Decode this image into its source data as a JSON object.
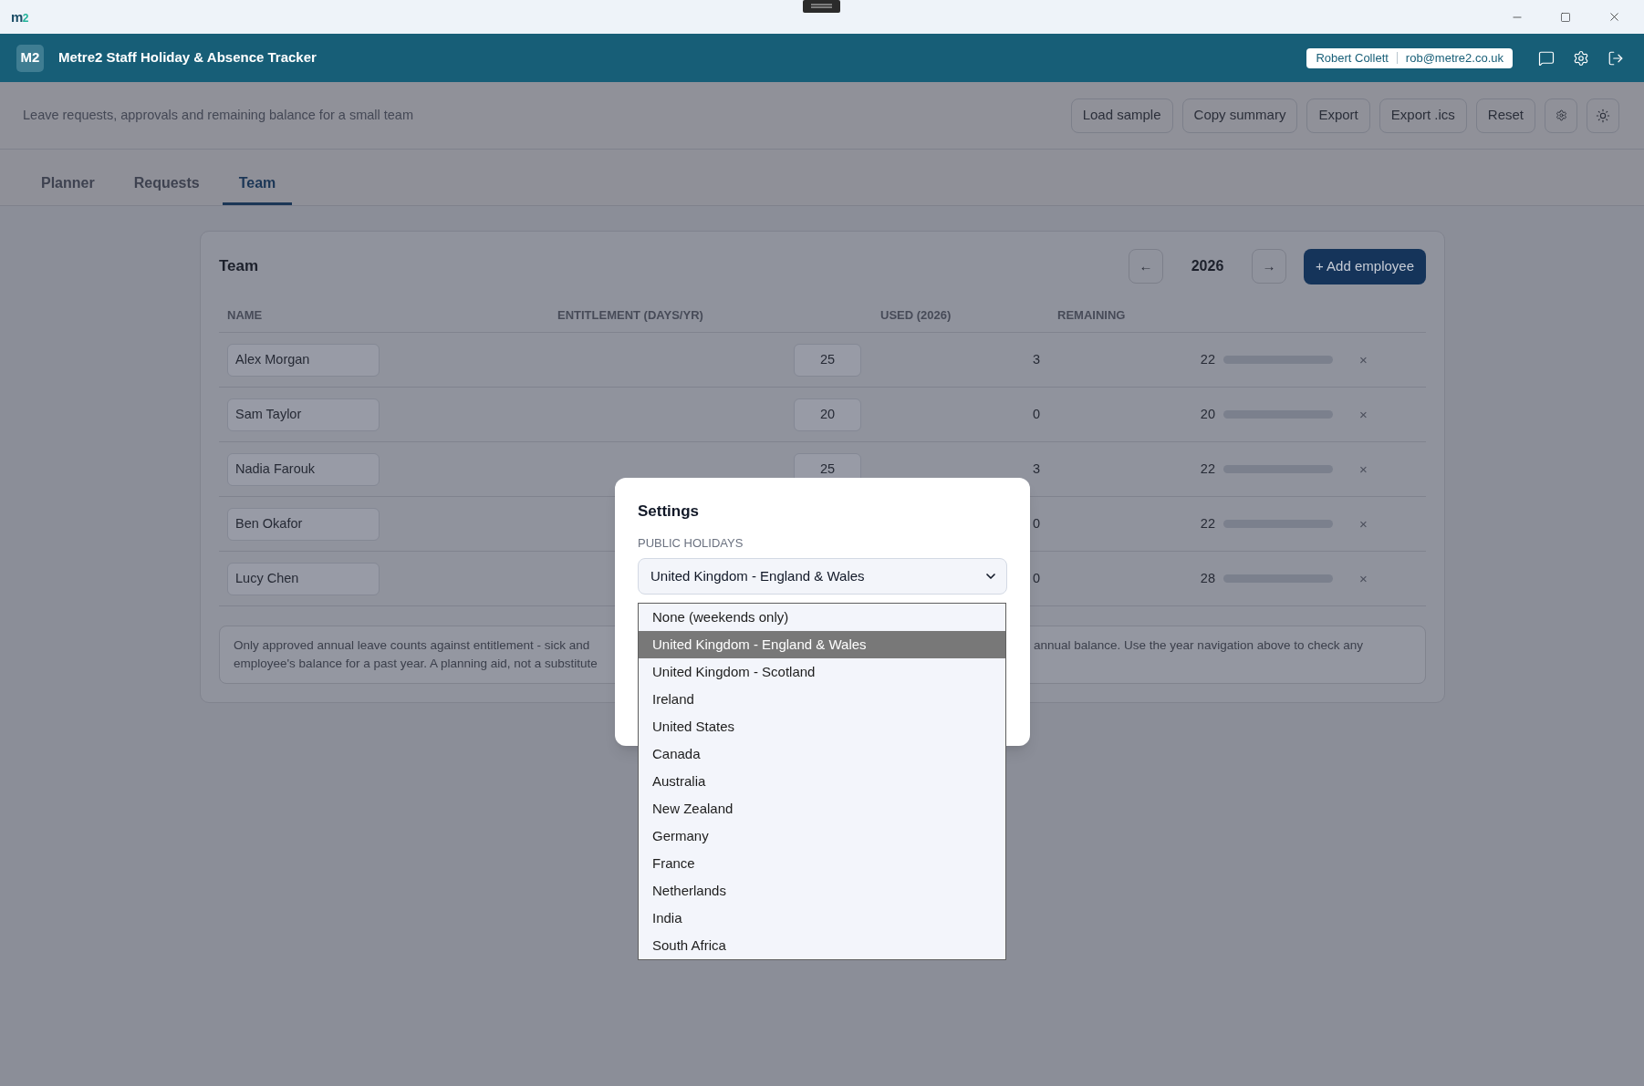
{
  "title_bar": {
    "logo": "m2"
  },
  "header": {
    "badge": "M2",
    "title": "Metre2 Staff Holiday & Absence Tracker",
    "user_name": "Robert Collett",
    "user_email": "rob@metre2.co.uk"
  },
  "toolbar": {
    "subtitle": "Leave requests, approvals and remaining balance for a small team",
    "buttons": [
      "Load sample",
      "Copy summary",
      "Export",
      "Export .ics",
      "Reset"
    ]
  },
  "tabs": [
    {
      "label": "Planner",
      "selected": false
    },
    {
      "label": "Requests",
      "selected": false
    },
    {
      "label": "Team",
      "selected": true
    }
  ],
  "team": {
    "title": "Team",
    "prev": "←",
    "year": "2026",
    "next": "→",
    "add_button": "+ Add employee",
    "columns": [
      "NAME",
      "ENTITLEMENT (DAYS/YR)",
      "USED (2026)",
      "REMAINING"
    ],
    "rows": [
      {
        "name": "Alex Morgan",
        "entitlement": "25",
        "used": "3",
        "remaining": "22",
        "delete": "×"
      },
      {
        "name": "Sam Taylor",
        "entitlement": "20",
        "used": "0",
        "remaining": "20",
        "delete": "×"
      },
      {
        "name": "Nadia Farouk",
        "entitlement": "25",
        "used": "3",
        "remaining": "22",
        "delete": "×"
      },
      {
        "name": "Ben Okafor",
        "used": "0",
        "remaining": "22",
        "delete": "×"
      },
      {
        "name": "Lucy Chen",
        "used": "0",
        "remaining": "28",
        "delete": "×"
      }
    ],
    "note": {
      "left_lines": [
        "Only approved annual leave counts against entitlement - sick and",
        "employee's balance for a past year. A planning aid, not a substitute"
      ],
      "right_lines": [
        "annual balance. Use the year navigation above to check any"
      ]
    }
  },
  "settings_dialog": {
    "title": "Settings",
    "field_label": "PUBLIC HOLIDAYS",
    "value": "United Kingdom - England & Wales",
    "options": [
      {
        "label": "None (weekends only)",
        "selected": false
      },
      {
        "label": "United Kingdom - England & Wales",
        "selected": true
      },
      {
        "label": "United Kingdom - Scotland",
        "selected": false
      },
      {
        "label": "Ireland",
        "selected": false
      },
      {
        "label": "United States",
        "selected": false
      },
      {
        "label": "Canada",
        "selected": false
      },
      {
        "label": "Australia",
        "selected": false
      },
      {
        "label": "New Zealand",
        "selected": false
      },
      {
        "label": "Germany",
        "selected": false
      },
      {
        "label": "France",
        "selected": false
      },
      {
        "label": "Netherlands",
        "selected": false
      },
      {
        "label": "India",
        "selected": false
      },
      {
        "label": "South Africa",
        "selected": false
      }
    ]
  }
}
